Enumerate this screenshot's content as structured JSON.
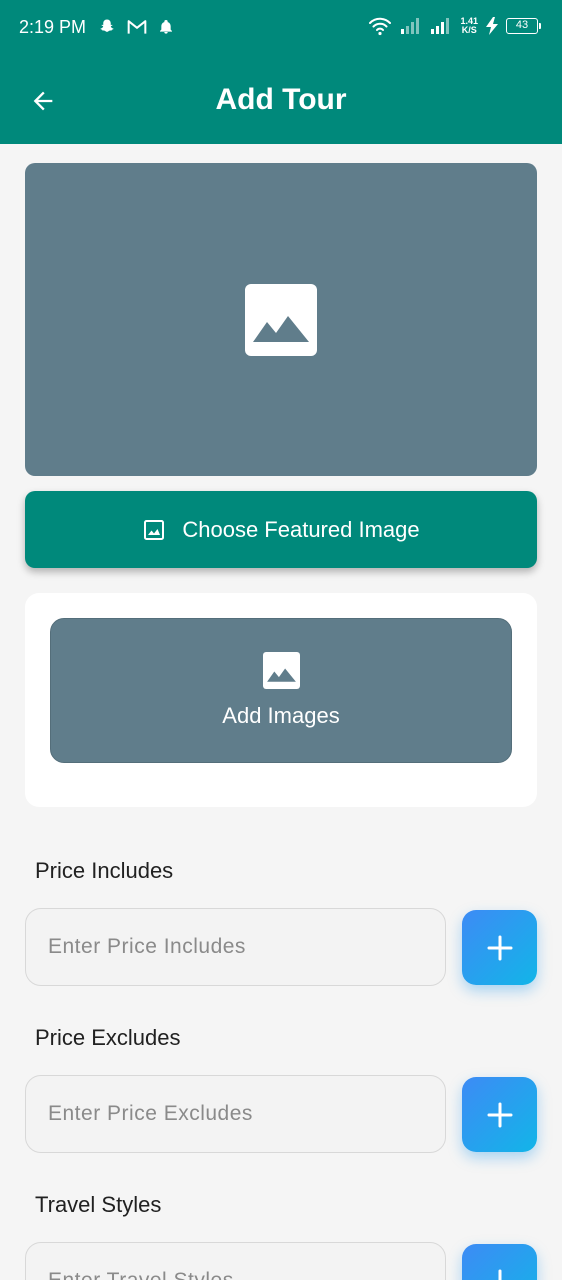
{
  "status_bar": {
    "time": "2:19 PM",
    "net_speed_value": "1.41",
    "net_speed_unit": "K/S",
    "battery": "43",
    "icons": [
      "snapchat-icon",
      "gmail-icon",
      "notification-icon",
      "wifi-icon",
      "signal-icon",
      "signal-icon",
      "charging-icon",
      "battery-icon"
    ]
  },
  "app_bar": {
    "title": "Add Tour",
    "back_icon": "arrow-back-icon"
  },
  "featured": {
    "placeholder_icon": "image-icon",
    "button_label": "Choose Featured Image",
    "button_icon": "image-icon"
  },
  "images": {
    "button_label": "Add Images",
    "button_icon": "image-icon"
  },
  "fields": [
    {
      "label": "Price Includes",
      "placeholder": "Enter Price Includes",
      "value": ""
    },
    {
      "label": "Price Excludes",
      "placeholder": "Enter Price Excludes",
      "value": ""
    },
    {
      "label": "Travel Styles",
      "placeholder": "Enter Travel Styles",
      "value": ""
    }
  ],
  "colors": {
    "primary": "#00897b",
    "image_placeholder": "#607d8b",
    "add_button_gradient_start": "#3d8bf5",
    "add_button_gradient_end": "#12b5e8",
    "background": "#f5f5f5"
  }
}
